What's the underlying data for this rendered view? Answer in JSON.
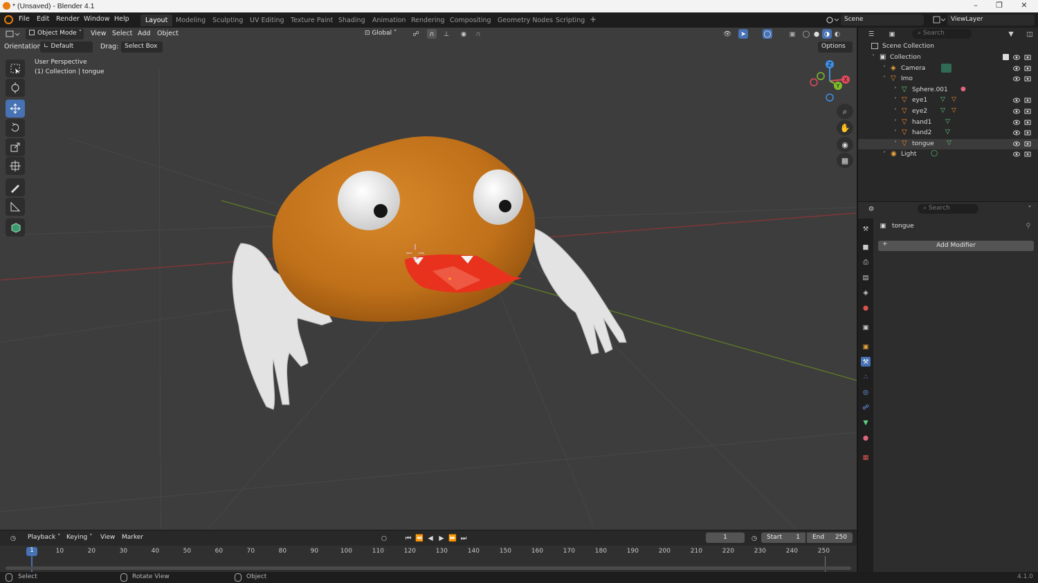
{
  "window": {
    "title": "* (Unsaved) - Blender 4.1",
    "controls": [
      "minimize",
      "maximize",
      "close"
    ]
  },
  "menu": [
    "File",
    "Edit",
    "Render",
    "Window",
    "Help"
  ],
  "workspaces": {
    "active": "Layout",
    "tabs": [
      "Layout",
      "Modeling",
      "Sculpting",
      "UV Editing",
      "Texture Paint",
      "Shading",
      "Animation",
      "Rendering",
      "Compositing",
      "Geometry Nodes",
      "Scripting"
    ],
    "add": "+"
  },
  "scene": {
    "name": "Scene",
    "view_layer": "ViewLayer"
  },
  "viewport": {
    "mode": "Object Mode",
    "menus": [
      "View",
      "Select",
      "Add",
      "Object"
    ],
    "transform_orientation": "Global",
    "orientation_label": "Orientation:",
    "orientation_value": "Default",
    "drag_label": "Drag:",
    "drag_value": "Select Box",
    "options_label": "Options",
    "perspective": "User Perspective",
    "collection_info": "(1) Collection | tongue",
    "gizmo_axes": [
      "X",
      "Y",
      "Z"
    ]
  },
  "tools": [
    {
      "name": "select-box",
      "active": false
    },
    {
      "name": "cursor",
      "active": false
    },
    {
      "name": "move",
      "active": true
    },
    {
      "name": "rotate",
      "active": false
    },
    {
      "name": "scale",
      "active": false
    },
    {
      "name": "transform",
      "active": false
    },
    {
      "name": "annotate",
      "active": false
    },
    {
      "name": "measure",
      "active": false
    },
    {
      "name": "add-cube",
      "active": false
    }
  ],
  "outliner": {
    "search_placeholder": "Search",
    "root": "Scene Collection",
    "items": [
      {
        "label": "Collection",
        "depth": 0,
        "icon": "collection-icon",
        "expanded": true
      },
      {
        "label": "Camera",
        "depth": 1,
        "icon": "camera-icon",
        "expanded": false
      },
      {
        "label": "Imo",
        "depth": 1,
        "icon": "mesh-icon",
        "expanded": true
      },
      {
        "label": "Sphere.001",
        "depth": 2,
        "icon": "mesh-data-icon",
        "expanded": false
      },
      {
        "label": "eye1",
        "depth": 2,
        "icon": "mesh-icon",
        "expanded": false
      },
      {
        "label": "eye2",
        "depth": 2,
        "icon": "mesh-icon",
        "expanded": false
      },
      {
        "label": "hand1",
        "depth": 2,
        "icon": "mesh-icon",
        "expanded": false
      },
      {
        "label": "hand2",
        "depth": 2,
        "icon": "mesh-icon",
        "expanded": false
      },
      {
        "label": "tongue",
        "depth": 2,
        "icon": "mesh-icon",
        "expanded": false
      },
      {
        "label": "Light",
        "depth": 1,
        "icon": "light-icon",
        "expanded": false
      }
    ]
  },
  "properties": {
    "search_placeholder": "Search",
    "object_name": "tongue",
    "add_modifier": "Add Modifier"
  },
  "timeline": {
    "menus": [
      "Playback",
      "Keying",
      "View",
      "Marker"
    ],
    "current_frame": "1",
    "start_label": "Start",
    "start": "1",
    "end_label": "End",
    "end": "250",
    "ruler": [
      "10",
      "20",
      "30",
      "40",
      "50",
      "60",
      "70",
      "80",
      "90",
      "100",
      "110",
      "120",
      "130",
      "140",
      "150",
      "160",
      "170",
      "180",
      "190",
      "200",
      "210",
      "220",
      "230",
      "240",
      "250"
    ],
    "playhead": "1"
  },
  "statusbar": {
    "select": "Select",
    "rotate": "Rotate View",
    "object": "Object",
    "version": "4.1.0"
  },
  "colors": {
    "accent": "#4772b3",
    "body_orange": "#c7771b",
    "tongue_red": "#e8321e",
    "grid_x": "#a33a3a",
    "grid_y": "#6a8f2a"
  }
}
